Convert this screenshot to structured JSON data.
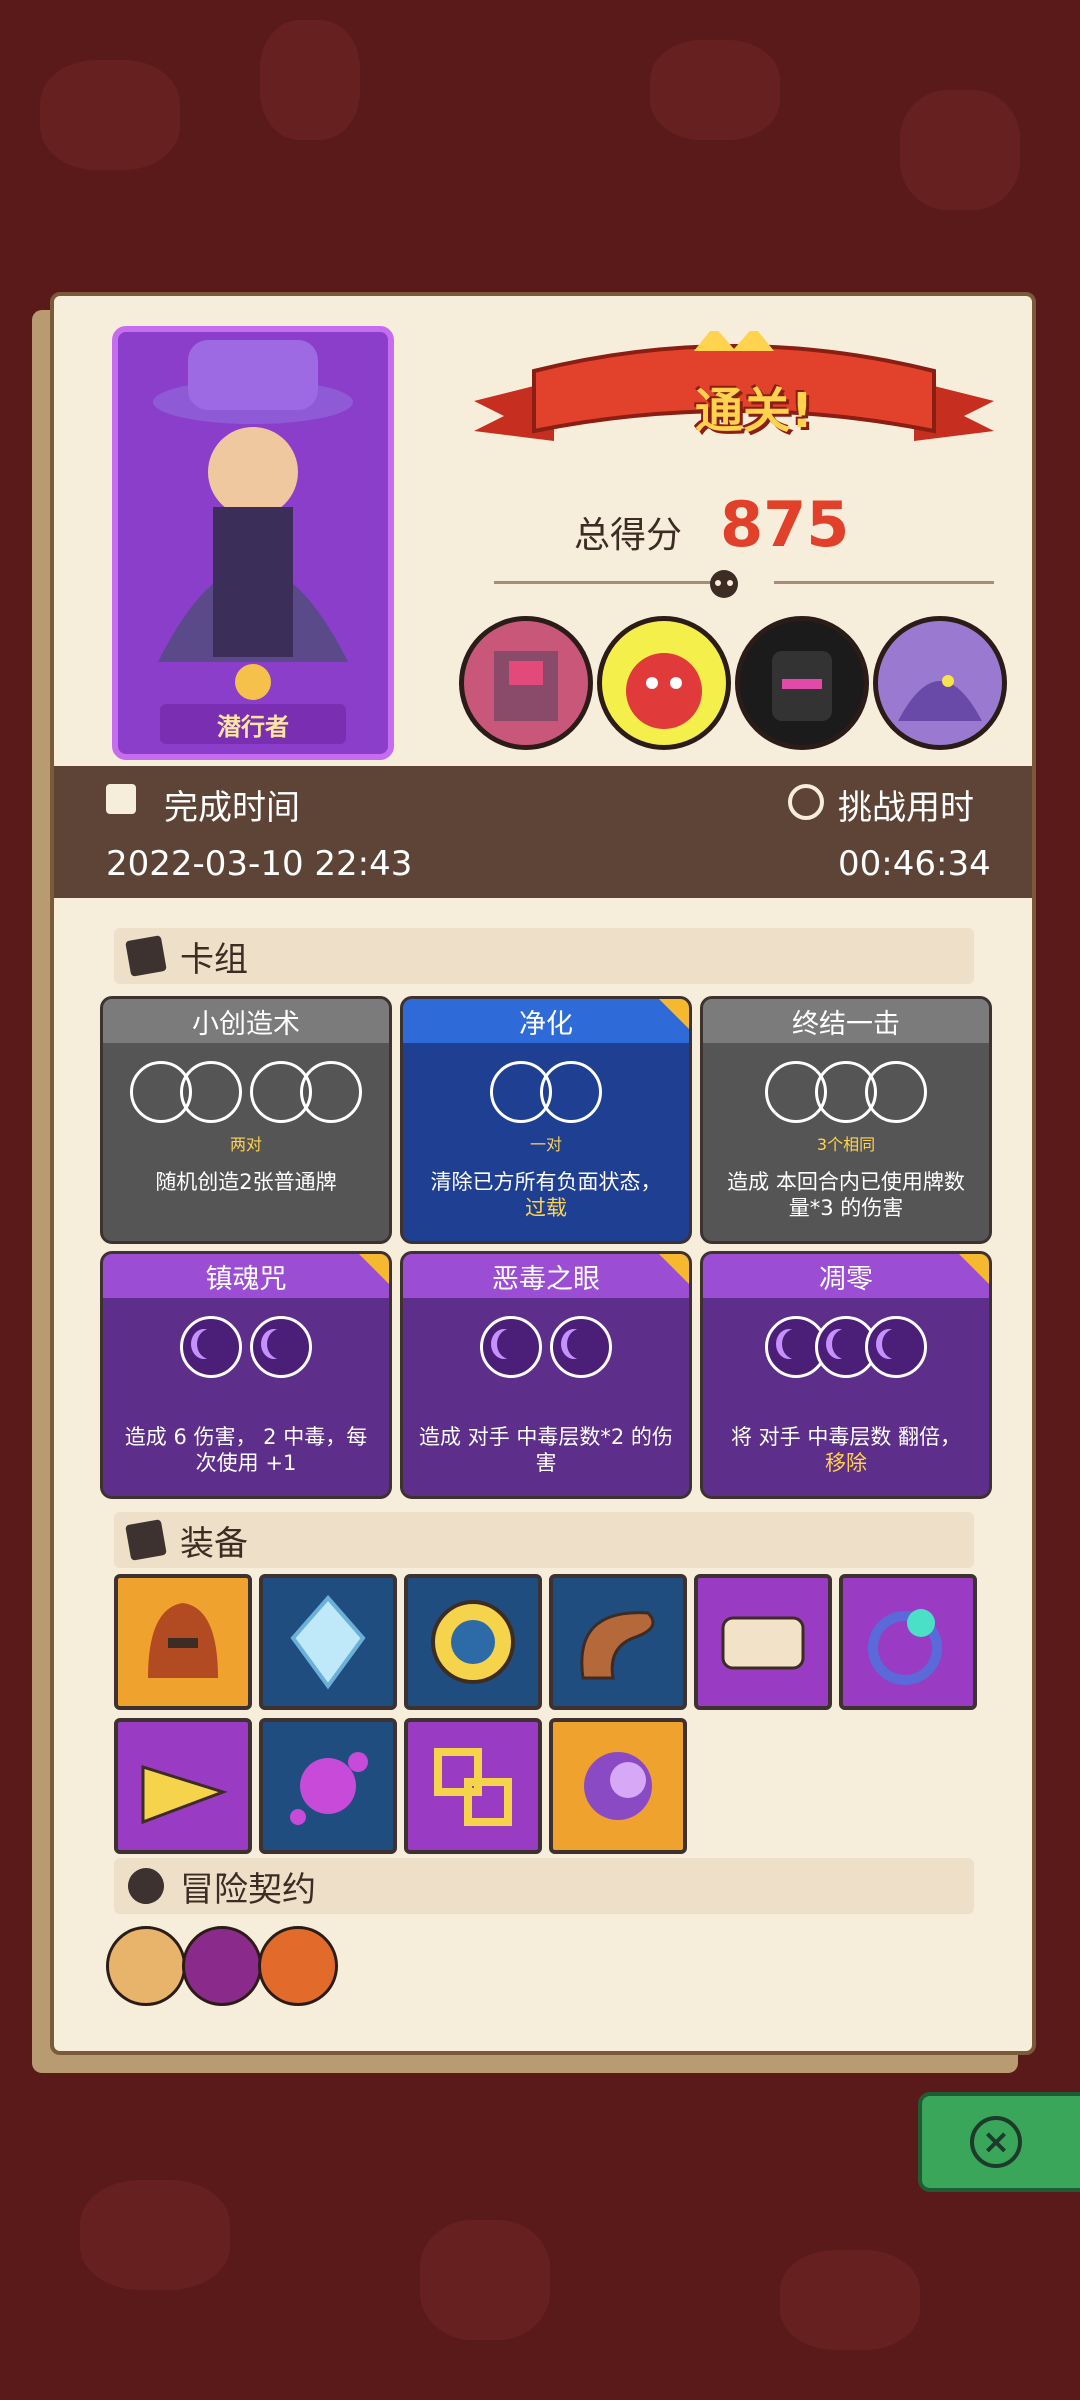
{
  "result": {
    "banner": "通关!",
    "score_label": "总得分",
    "score": "875"
  },
  "hero": {
    "name": "潜行者"
  },
  "info": {
    "finish_label": "完成时间",
    "finish_value": "2022-03-10 22:43",
    "duration_label": "挑战用时",
    "duration_value": "00:46:34"
  },
  "sections": {
    "deck": "卡组",
    "equipment": "装备",
    "contract": "冒险契约"
  },
  "skills": [
    {
      "title": "小创造术",
      "note": "两对",
      "desc": "随机创造2张普通牌",
      "desc_highlight": ""
    },
    {
      "title": "净化",
      "note": "一对",
      "desc": "清除已方所有负面状态，",
      "desc_highlight": "过载"
    },
    {
      "title": "终结一击",
      "note": "3个相同",
      "desc": "造成 本回合内已使用牌数量*3 的伤害",
      "desc_highlight": ""
    },
    {
      "title": "镇魂咒",
      "note": "",
      "desc": "造成 6 伤害， 2 中毒，每次使用 +1",
      "desc_highlight": ""
    },
    {
      "title": "恶毒之眼",
      "note": "",
      "desc": "造成 对手 中毒层数*2 的伤害",
      "desc_highlight": ""
    },
    {
      "title": "凋零",
      "note": "",
      "desc": "将 对手 中毒层数 翻倍，",
      "desc_highlight": "移除"
    }
  ],
  "equipment_icons": [
    "helmet-icon",
    "crystal-icon",
    "amulet-icon",
    "horn-icon",
    "scroll-icon",
    "ring-icon",
    "cheese-icon",
    "splash-icon",
    "chain-icon",
    "moon-orb-icon"
  ],
  "contract_icons": [
    "scroll-contract-icon",
    "spear-contract-icon",
    "feast-contract-icon"
  ]
}
